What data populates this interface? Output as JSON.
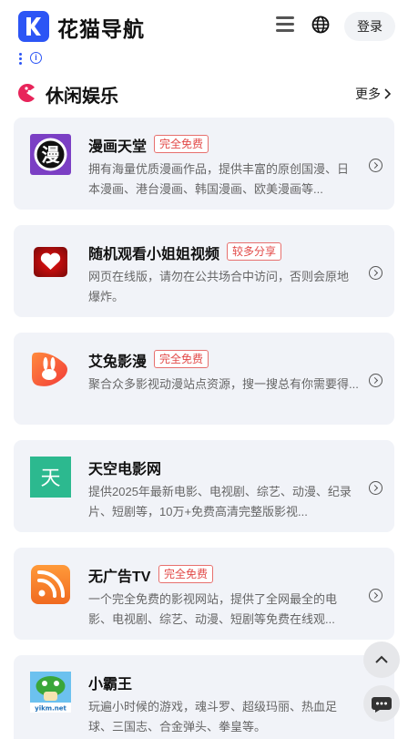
{
  "header": {
    "brand": "花猫导航",
    "login_label": "登录"
  },
  "section": {
    "title": "休闲娱乐",
    "more_label": "更多"
  },
  "cards": [
    {
      "title": "漫画天堂",
      "badge": "完全免费",
      "desc": "拥有海量优质漫画作品，提供丰富的原创国漫、日本漫画、港台漫画、韩国漫画、欧美漫画等...",
      "icon": "manga-icon",
      "icon_text": "漫"
    },
    {
      "title": "随机观看小姐姐视频",
      "badge": "较多分享",
      "desc": "网页在线版，请勿在公共场合中访问，否则会原地爆炸。",
      "icon": "heart-video-icon"
    },
    {
      "title": "艾兔影漫",
      "badge": "完全免费",
      "desc": "聚合众多影视动漫站点资源，搜一搜总有你需要得...",
      "icon": "rabbit-icon"
    },
    {
      "title": "天空电影网",
      "badge": "",
      "desc": "提供2025年最新电影、电视剧、综艺、动漫、纪录片、短剧等，10万+免费高清完整版影视...",
      "icon": "tian-icon",
      "icon_text": "天"
    },
    {
      "title": "无广告TV",
      "badge": "完全免费",
      "desc": "一个完全免费的影视网站，提供了全网最全的电影、电视剧、综艺、动漫、短剧等免费在线观...",
      "icon": "rss-tv-icon"
    },
    {
      "title": "小霸王",
      "badge": "",
      "desc": "玩遍小时候的游戏，魂斗罗、超级玛丽、热血足球、三国志、合金弹头、拳皇等。",
      "icon": "mushroom-game-icon",
      "icon_text": "yikm.net"
    }
  ]
}
